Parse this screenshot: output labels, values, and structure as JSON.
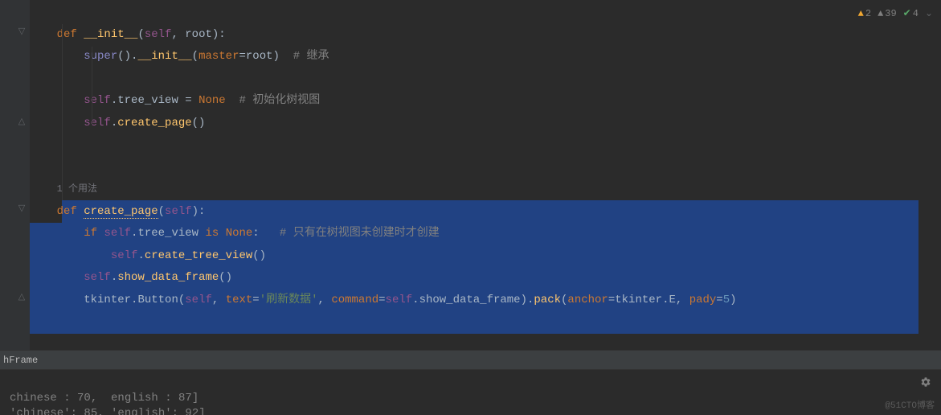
{
  "indicators": {
    "warning_count": "2",
    "weak_warning_count": "39",
    "typo_count": "4"
  },
  "code": {
    "usage_hint": "1 个用法",
    "line1": {
      "kw_def": "def ",
      "fn": "__init__",
      "open": "(",
      "self": "self",
      "comma": ", ",
      "param": "root",
      "close": "):"
    },
    "line2": {
      "call": "super",
      "open": "().",
      "fn": "__init__",
      "p1": "(",
      "kw": "master",
      "eq": "=",
      "arg": "root",
      "close": ")",
      "comment": "  # 继承"
    },
    "line4": {
      "self": "self",
      "dot": ".",
      "attr": "tree_view",
      "eq": " = ",
      "none": "None",
      "comment": "  # 初始化树视图"
    },
    "line5": {
      "self": "self",
      "dot": ".",
      "fn": "create_page",
      "call": "()"
    },
    "line9": {
      "kw_def": "def ",
      "fn": "create_page",
      "open": "(",
      "self": "self",
      "close": "):"
    },
    "line10": {
      "kw_if": "if ",
      "self": "self",
      "dot": ".",
      "attr": "tree_view",
      "is": " is ",
      "none": "None",
      "colon": ":",
      "comment": "   # 只有在树视图未创建时才创建"
    },
    "line11": {
      "self": "self",
      "dot": ".",
      "fn": "create_tree_view",
      "call": "()"
    },
    "line12": {
      "self": "self",
      "dot": ".",
      "fn": "show_data_frame",
      "call": "()"
    },
    "line13": {
      "mod": "tkinter",
      "dot1": ".",
      "cls": "Button",
      "open": "(",
      "self": "self",
      "c1": ", ",
      "k1": "text",
      "eq1": "=",
      "str": "'刷新数据'",
      "c2": ", ",
      "k2": "command",
      "eq2": "=",
      "self2": "self",
      "dot2": ".",
      "attr2": "show_data_frame",
      "close": ").",
      "pack": "pack",
      "popen": "(",
      "k3": "anchor",
      "eq3": "=",
      "mod2": "tkinter",
      "dot3": ".",
      "e": "E",
      "c3": ", ",
      "k4": "pady",
      "eq4": "=",
      "num": "5",
      "pclose": ")"
    }
  },
  "breadcrumb": "hFrame",
  "bottom": {
    "line1": "chinese : 70,  english : 87]",
    "line2": "'chinese': 85, 'english': 92]"
  },
  "watermark": "@51CTO博客"
}
